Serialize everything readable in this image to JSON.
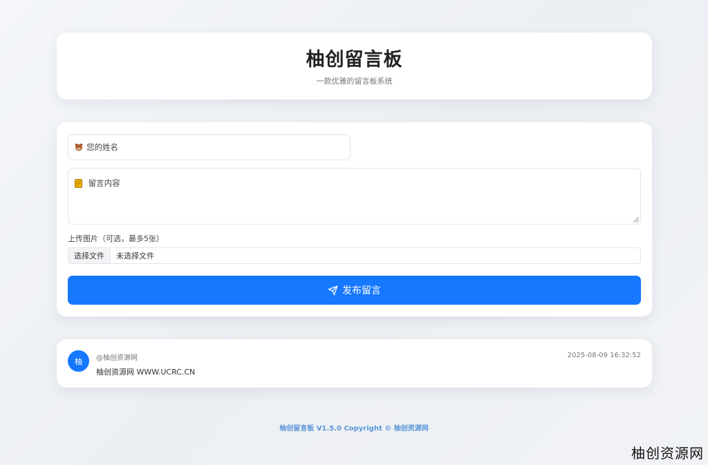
{
  "header": {
    "title": "柚创留言板",
    "subtitle": "一款优雅的留言板系统"
  },
  "form": {
    "name_placeholder": "您的姓名",
    "name_icon": "bear-face-icon",
    "content_placeholder": "留言内容",
    "content_icon": "memo-icon",
    "upload_label": "上传图片（可选，最多5张）",
    "file_button_label": "选择文件",
    "file_status": "未选择文件",
    "submit_label": "发布留言",
    "submit_icon": "paper-plane-icon",
    "accent_color": "#1677ff"
  },
  "messages": [
    {
      "avatar_text": "柚",
      "author": "@柚创资源网",
      "time": "2025-08-09 16:32:52",
      "text": "柚创资源网 WWW.UCRC.CN"
    }
  ],
  "footer": {
    "text": "柚创留言板 V1.5.0 Copyright © 柚创资源网"
  },
  "watermark": {
    "text": "柚创资源网"
  }
}
